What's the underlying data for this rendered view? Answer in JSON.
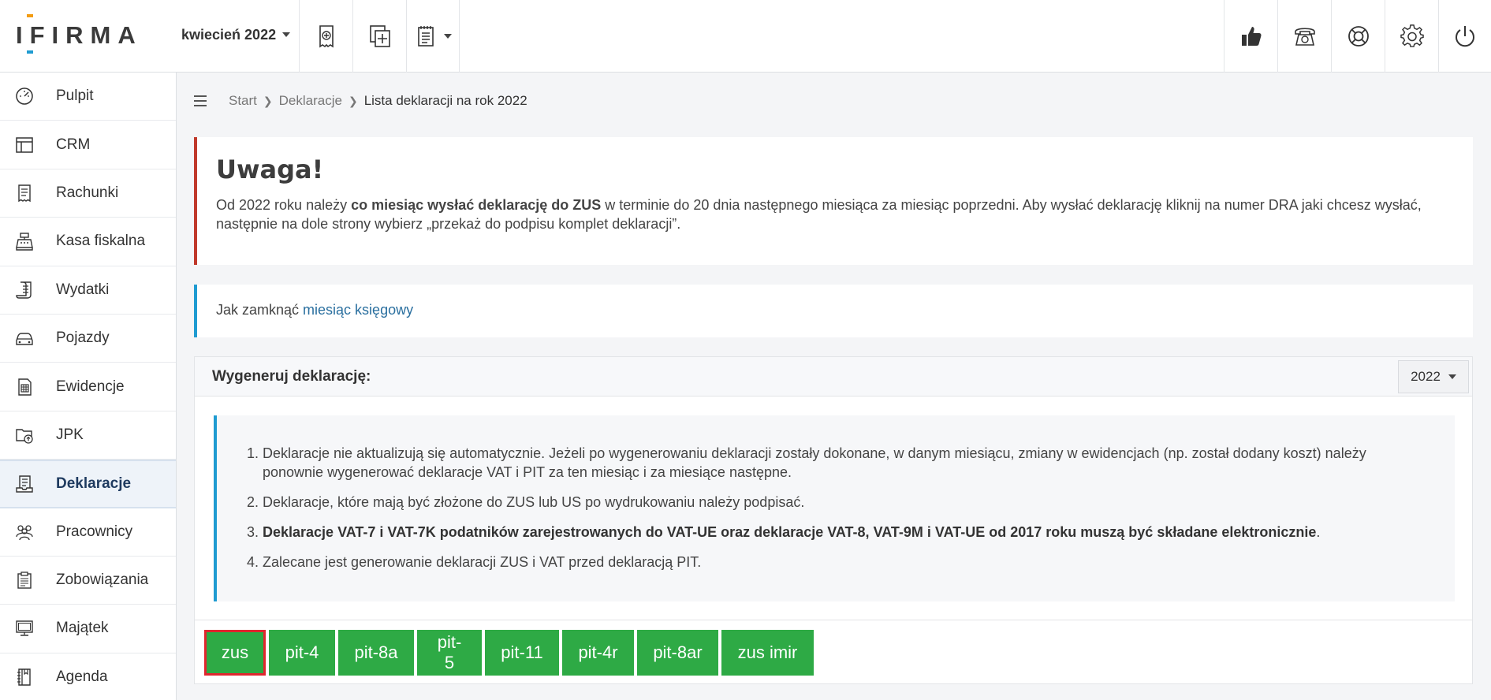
{
  "header": {
    "logo_text": "IFIRMA",
    "month_label": "kwiecień 2022"
  },
  "breadcrumb": {
    "items": [
      "Start",
      "Deklaracje"
    ],
    "current": "Lista deklaracji na rok 2022"
  },
  "sidebar": {
    "items": [
      {
        "label": "Pulpit"
      },
      {
        "label": "CRM"
      },
      {
        "label": "Rachunki"
      },
      {
        "label": "Kasa fiskalna"
      },
      {
        "label": "Wydatki"
      },
      {
        "label": "Pojazdy"
      },
      {
        "label": "Ewidencje"
      },
      {
        "label": "JPK"
      },
      {
        "label": "Deklaracje"
      },
      {
        "label": "Pracownicy"
      },
      {
        "label": "Zobowiązania"
      },
      {
        "label": "Majątek"
      },
      {
        "label": "Agenda"
      }
    ],
    "active": "Deklaracje"
  },
  "warning": {
    "title": "Uwaga!",
    "text_before": "Od 2022 roku należy ",
    "text_bold": "co miesiąc wysłać deklarację do ZUS",
    "text_after": " w terminie do 20 dnia następnego miesiąca za miesiąc poprzedni. Aby wysłać deklarację kliknij na numer DRA jaki chcesz wysłać, następnie na dole strony wybierz „przekaż do podpisu komplet deklaracji”."
  },
  "info": {
    "text": "Jak zamknąć ",
    "link": "miesiąc księgowy"
  },
  "panel": {
    "title": "Wygeneruj deklarację:",
    "year": "2022",
    "notes": [
      {
        "text": "Deklaracje nie aktualizują się automatycznie. Jeżeli po wygenerowaniu deklaracji zostały dokonane, w danym miesiącu, zmiany w ewidencjach (np. został dodany koszt) należy ponownie wygenerować deklaracje VAT i PIT za ten miesiąc i za miesiące następne."
      },
      {
        "text": "Deklaracje, które mają być złożone do ZUS lub US po wydrukowaniu należy podpisać."
      },
      {
        "bold": "Deklaracje VAT-7 i VAT-7K podatników zarejestrowanych do VAT-UE oraz deklaracje VAT-8, VAT-9M i VAT-UE od 2017 roku muszą być składane elektronicznie",
        "text": "."
      },
      {
        "text": "Zalecane jest generowanie deklaracji ZUS i VAT przed deklaracją PIT."
      }
    ],
    "buttons": [
      "zus",
      "pit-4",
      "pit-8a",
      "pit-5",
      "pit-11",
      "pit-4r",
      "pit-8ar",
      "zus imir"
    ],
    "selected_button": "zus"
  },
  "colors": {
    "button_green": "#2eaa45",
    "warning_border": "#c0392b",
    "info_border": "#1f9bd1",
    "highlight_red": "#e0262e",
    "logo_orange": "#f39c12",
    "logo_blue": "#1f9bd1"
  }
}
